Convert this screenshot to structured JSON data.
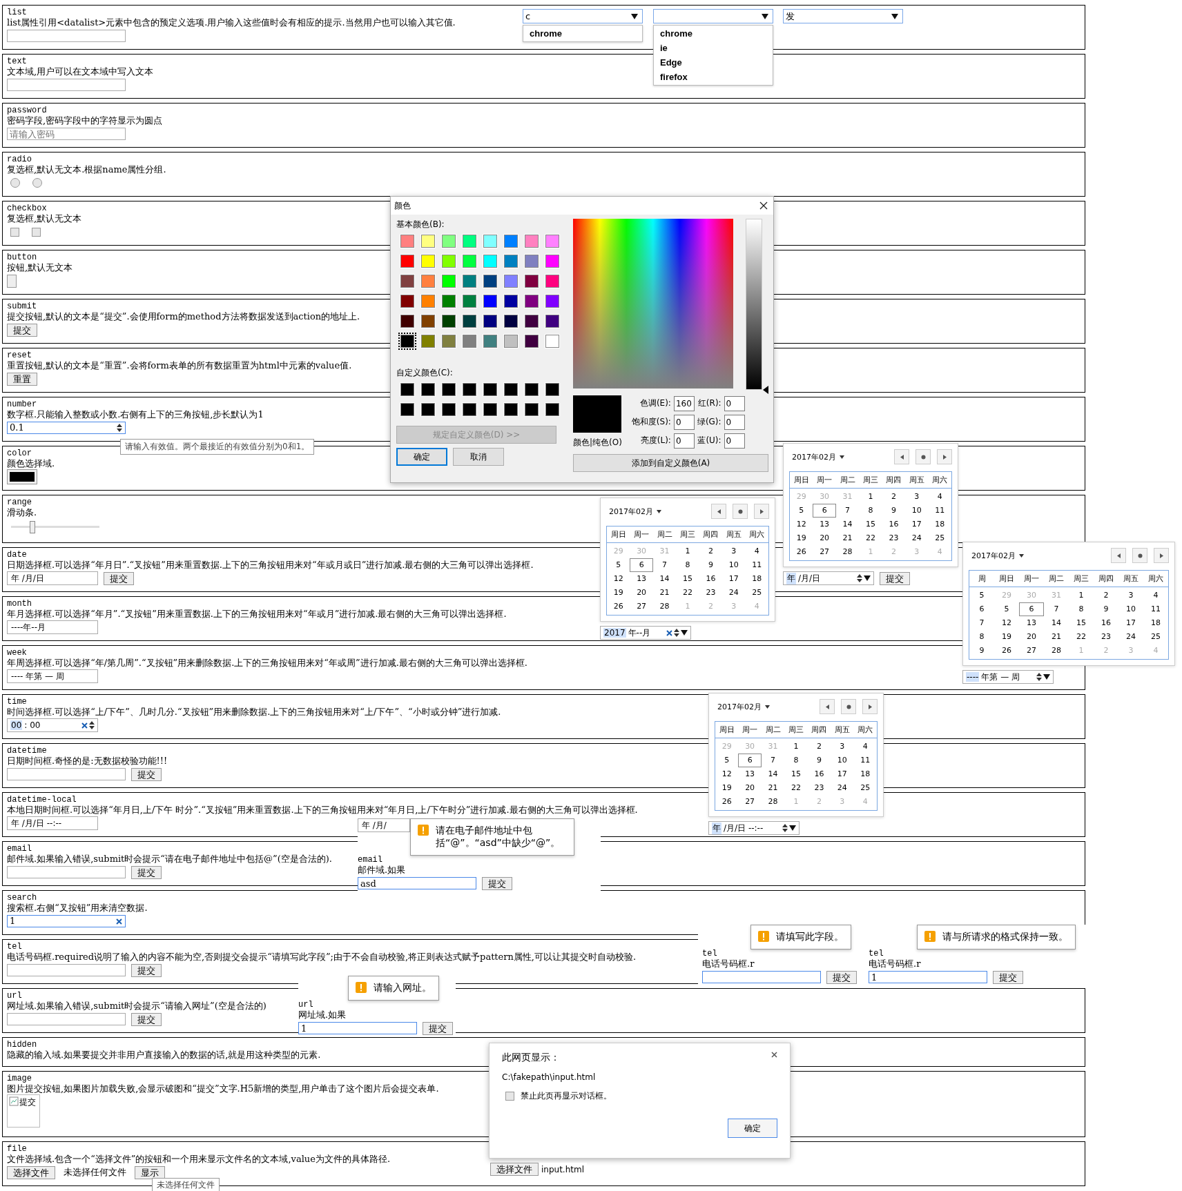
{
  "sections": [
    {
      "type": "list",
      "description": "list属性引用<datalist>元素中包含的预定义选项.用户输入这些值时会有相应的提示.当然用户也可以输入其它值.",
      "controls": [
        {
          "kind": "input"
        }
      ]
    },
    {
      "type": "text",
      "description": "文本域,用户可以在文本域中写入文本",
      "controls": [
        {
          "kind": "input"
        }
      ]
    },
    {
      "type": "password",
      "description": "密码字段,密码字段中的字符显示为圆点",
      "controls": [
        {
          "kind": "input",
          "placeholder": "请输入密码"
        }
      ]
    },
    {
      "type": "radio",
      "description": "复选框,默认无文本.根据name属性分组.",
      "controls": [
        {
          "kind": "radio",
          "checked": false
        },
        {
          "kind": "radio",
          "checked": false
        }
      ]
    },
    {
      "type": "checkbox",
      "description": "复选框,默认无文本",
      "controls": [
        {
          "kind": "checkbox",
          "checked": false
        },
        {
          "kind": "checkbox",
          "checked": false
        }
      ]
    },
    {
      "type": "button",
      "description": "按钮,默认无文本",
      "controls": [
        {
          "kind": "button"
        }
      ]
    },
    {
      "type": "submit",
      "description": "提交按钮,默认的文本是“提交”.会使用form的method方法将数据发送到action的地址上.",
      "controls": [
        {
          "kind": "button",
          "label": "提交"
        }
      ]
    },
    {
      "type": "reset",
      "description": "重置按钮,默认的文本是“重置”.会将form表单的所有数据重置为html中元素的value值.",
      "controls": [
        {
          "kind": "button",
          "label": "重置"
        }
      ]
    },
    {
      "type": "number",
      "description": "数字框.只能输入整数或小数.右侧有上下的三角按钮,步长默认为1",
      "controls": [
        {
          "kind": "input",
          "value": "0.1",
          "focused": true,
          "spinner": true
        }
      ]
    },
    {
      "type": "color",
      "description": "颜色选择域.",
      "controls": [
        {
          "kind": "color"
        }
      ]
    },
    {
      "type": "range",
      "description": "滑动条.",
      "controls": [
        {
          "kind": "range",
          "level": 0.24
        }
      ]
    },
    {
      "type": "date",
      "description": "日期选择框.可以选择“年月日”.“叉按钮”用来重置数据.上下的三角按钮用来对“年或月或日”进行加减.最右侧的大三角可以弹出选择框.",
      "controls": [
        {
          "kind": "datefield",
          "segments": [
            {
              "text": "年 /月/日",
              "selected": false
            }
          ]
        },
        {
          "kind": "button",
          "label": "提交"
        }
      ]
    },
    {
      "type": "month",
      "description": "年月选择框.可以选择“年月”.“叉按钮”用来重置数据.上下的三角按钮用来对“年或月”进行加减.最右侧的大三角可以弹出选择框.",
      "controls": [
        {
          "kind": "datefield",
          "segments": [
            {
              "text": "----年--月",
              "selected": false
            }
          ]
        }
      ]
    },
    {
      "type": "week",
      "description": "年周选择框.可以选择“年/第几周”.“叉按钮”用来删除数据.上下的三角按钮用来对“年或周”进行加减.最右侧的大三角可以弹出选择框.",
      "controls": [
        {
          "kind": "datefield",
          "segments": [
            {
              "text": "---- 年第 — 周",
              "selected": false
            }
          ]
        }
      ]
    },
    {
      "type": "time",
      "description": "时间选择框.可以选择“上/下午”、几时几分.“叉按钮”用来删除数据.上下的三角按钮用来对“上/下午”、“小时或分钟”进行加减.",
      "controls": [
        {
          "kind": "datefield",
          "segments": [
            {
              "text": "00",
              "selected": true
            },
            {
              "text": ": 00",
              "selected": false
            }
          ],
          "clear": true,
          "spinner": true
        }
      ]
    },
    {
      "type": "datetime",
      "description": "日期时间框.奇怪的是:无数据校验功能!!!",
      "controls": [
        {
          "kind": "input"
        },
        {
          "kind": "button",
          "label": "提交"
        }
      ]
    },
    {
      "type": "datetime-local",
      "description": "本地日期时间框.可以选择“年月日,上/下午 时分”.“叉按钮”用来重置数据.上下的三角按钮用来对“年月日,上/下午时分”进行加减.最右侧的大三角可以弹出选择框.",
      "controls": [
        {
          "kind": "datefield",
          "segments": [
            {
              "text": "年 /月/日 --:--",
              "selected": false
            }
          ]
        }
      ]
    },
    {
      "type": "email",
      "description": "邮件域.如果输入错误,submit时会提示“请在电子邮件地址中包括@”(空是合法的).",
      "controls": [
        {
          "kind": "input"
        },
        {
          "kind": "button",
          "label": "提交"
        }
      ]
    },
    {
      "type": "search",
      "description": "搜索框.右侧“叉按钮”用来清空数据.",
      "controls": [
        {
          "kind": "input",
          "value": "1",
          "focused": true,
          "clear": true
        }
      ]
    },
    {
      "type": "tel",
      "description": "电话号码框.required说明了输入的内容不能为空,否则提交会提示“请填写此字段”;由于不会自动校验,将正则表达式赋予pattern属性,可以让其提交时自动校验.",
      "controls": [
        {
          "kind": "input"
        },
        {
          "kind": "button",
          "label": "提交"
        }
      ]
    },
    {
      "type": "url",
      "description": "网址域.如果输入错误,submit时会提示“请输入网址”(空是合法的)",
      "controls": [
        {
          "kind": "input"
        },
        {
          "kind": "button",
          "label": "提交"
        }
      ]
    },
    {
      "type": "hidden",
      "description": "隐藏的输入域.如果要提交并非用户直接输入的数据的话,就是用这种类型的元素."
    },
    {
      "type": "image",
      "description": "图片提交按钮,如果图片加载失败,会显示破图和“提交”文字.H5新增的类型,用户单击了这个图片后会提交表单.",
      "controls": [
        {
          "kind": "image",
          "alt": "提交"
        }
      ]
    },
    {
      "type": "file",
      "description": "文件选择域.包含一个“选择文件”的按钮和一个用来显示文件名的文本域,value为文件的具体路径.",
      "controls": [
        {
          "kind": "file",
          "button": "选择文件",
          "filename": "未选择任何文件"
        },
        {
          "kind": "button",
          "label": "显示"
        }
      ]
    }
  ],
  "datalist_combos": [
    {
      "value": "c",
      "options": [
        "chrome"
      ]
    },
    {
      "options": [
        "chrome",
        "ie",
        "Edge",
        "firefox"
      ]
    },
    {
      "value": "发"
    }
  ],
  "number_tooltip": "请输入有效值。两个最接近的有效值分别为0和1。",
  "color_dialog": {
    "title": "颜色",
    "basic_label": "基本颜色(B):",
    "basic_colors": [
      {
        "color": "#ff8080",
        "selected": false
      },
      {
        "color": "#ffff80",
        "selected": false
      },
      {
        "color": "#80ff80",
        "selected": false
      },
      {
        "color": "#00ff80",
        "selected": false
      },
      {
        "color": "#80ffff",
        "selected": false
      },
      {
        "color": "#0080ff",
        "selected": false
      },
      {
        "color": "#ff80c0",
        "selected": false
      },
      {
        "color": "#ff80ff",
        "selected": false
      },
      {
        "color": "#ff0000",
        "selected": false
      },
      {
        "color": "#ffff00",
        "selected": false
      },
      {
        "color": "#80ff00",
        "selected": false
      },
      {
        "color": "#00ff40",
        "selected": false
      },
      {
        "color": "#00ffff",
        "selected": false
      },
      {
        "color": "#0080c0",
        "selected": false
      },
      {
        "color": "#8080c0",
        "selected": false
      },
      {
        "color": "#ff00ff",
        "selected": false
      },
      {
        "color": "#804040",
        "selected": false
      },
      {
        "color": "#ff8040",
        "selected": false
      },
      {
        "color": "#00ff00",
        "selected": false
      },
      {
        "color": "#008080",
        "selected": false
      },
      {
        "color": "#004080",
        "selected": false
      },
      {
        "color": "#8080ff",
        "selected": false
      },
      {
        "color": "#800040",
        "selected": false
      },
      {
        "color": "#ff0080",
        "selected": false
      },
      {
        "color": "#800000",
        "selected": false
      },
      {
        "color": "#ff8000",
        "selected": false
      },
      {
        "color": "#008000",
        "selected": false
      },
      {
        "color": "#008040",
        "selected": false
      },
      {
        "color": "#0000ff",
        "selected": false
      },
      {
        "color": "#0000a0",
        "selected": false
      },
      {
        "color": "#800080",
        "selected": false
      },
      {
        "color": "#8000ff",
        "selected": false
      },
      {
        "color": "#400000",
        "selected": false
      },
      {
        "color": "#804000",
        "selected": false
      },
      {
        "color": "#004000",
        "selected": false
      },
      {
        "color": "#004040",
        "selected": false
      },
      {
        "color": "#000080",
        "selected": false
      },
      {
        "color": "#000040",
        "selected": false
      },
      {
        "color": "#400040",
        "selected": false
      },
      {
        "color": "#400080",
        "selected": false
      },
      {
        "color": "#000000",
        "selected": true
      },
      {
        "color": "#808000",
        "selected": false
      },
      {
        "color": "#808040",
        "selected": false
      },
      {
        "color": "#808080",
        "selected": false
      },
      {
        "color": "#408080",
        "selected": false
      },
      {
        "color": "#c0c0c0",
        "selected": false
      },
      {
        "color": "#400040",
        "selected": false
      },
      {
        "color": "#ffffff",
        "selected": false
      }
    ],
    "luminance_slider": {
      "level": 0
    },
    "custom_label": "自定义颜色(C):",
    "custom_colors": [
      {
        "color": "#000000"
      },
      {
        "color": "#000000"
      },
      {
        "color": "#000000"
      },
      {
        "color": "#000000"
      },
      {
        "color": "#000000"
      },
      {
        "color": "#000000"
      },
      {
        "color": "#000000"
      },
      {
        "color": "#000000"
      },
      {
        "color": "#000000"
      },
      {
        "color": "#000000"
      },
      {
        "color": "#000000"
      },
      {
        "color": "#000000"
      },
      {
        "color": "#000000"
      },
      {
        "color": "#000000"
      },
      {
        "color": "#000000"
      },
      {
        "color": "#000000"
      }
    ],
    "define_button": {
      "label": "规定自定义颜色(D) >>",
      "disabled": true
    },
    "ok_button": "确定",
    "cancel_button": "取消",
    "preview_label": "颜色|纯色(O)",
    "fields": [
      {
        "label": "色调(E):",
        "value": "160"
      },
      {
        "label": "红(R):",
        "value": "0"
      },
      {
        "label": "饱和度(S):",
        "value": "0"
      },
      {
        "label": "绿(G):",
        "value": "0"
      },
      {
        "label": "亮度(L):",
        "value": "0"
      },
      {
        "label": "蓝(U):",
        "value": "0"
      }
    ],
    "add_button": "添加到自定义颜色(A)"
  },
  "calendars": [
    {
      "month": "2017年02月",
      "weekdays": [
        "周日",
        "周一",
        "周二",
        "周三",
        "周四",
        "周五",
        "周六"
      ],
      "weeks": [
        {
          "days": [
            {
              "day": "29",
              "outside": true,
              "selected": false
            },
            {
              "day": "30",
              "outside": true,
              "selected": false
            },
            {
              "day": "31",
              "outside": true,
              "selected": false
            },
            {
              "day": "1",
              "outside": false,
              "selected": false
            },
            {
              "day": "2",
              "outside": false,
              "selected": false
            },
            {
              "day": "3",
              "outside": false,
              "selected": false
            },
            {
              "day": "4",
              "outside": false,
              "selected": false
            }
          ]
        },
        {
          "days": [
            {
              "day": "5",
              "outside": false,
              "selected": false
            },
            {
              "day": "6",
              "outside": false,
              "selected": true
            },
            {
              "day": "7",
              "outside": false,
              "selected": false
            },
            {
              "day": "8",
              "outside": false,
              "selected": false
            },
            {
              "day": "9",
              "outside": false,
              "selected": false
            },
            {
              "day": "10",
              "outside": false,
              "selected": false
            },
            {
              "day": "11",
              "outside": false,
              "selected": false
            }
          ]
        },
        {
          "days": [
            {
              "day": "12",
              "outside": false,
              "selected": false
            },
            {
              "day": "13",
              "outside": false,
              "selected": false
            },
            {
              "day": "14",
              "outside": false,
              "selected": false
            },
            {
              "day": "15",
              "outside": false,
              "selected": false
            },
            {
              "day": "16",
              "outside": false,
              "selected": false
            },
            {
              "day": "17",
              "outside": false,
              "selected": false
            },
            {
              "day": "18",
              "outside": false,
              "selected": false
            }
          ]
        },
        {
          "days": [
            {
              "day": "19",
              "outside": false,
              "selected": false
            },
            {
              "day": "20",
              "outside": false,
              "selected": false
            },
            {
              "day": "21",
              "outside": false,
              "selected": false
            },
            {
              "day": "22",
              "outside": false,
              "selected": false
            },
            {
              "day": "23",
              "outside": false,
              "selected": false
            },
            {
              "day": "24",
              "outside": false,
              "selected": false
            },
            {
              "day": "25",
              "outside": false,
              "selected": false
            }
          ]
        },
        {
          "days": [
            {
              "day": "26",
              "outside": false,
              "selected": false
            },
            {
              "day": "27",
              "outside": false,
              "selected": false
            },
            {
              "day": "28",
              "outside": false,
              "selected": false
            },
            {
              "day": "1",
              "outside": true,
              "selected": false
            },
            {
              "day": "2",
              "outside": true,
              "selected": false
            },
            {
              "day": "3",
              "outside": true,
              "selected": false
            },
            {
              "day": "4",
              "outside": true,
              "selected": false
            }
          ]
        }
      ],
      "field": {
        "segments": [
          {
            "text": "2017",
            "selected": true
          },
          {
            "text": "年--月",
            "selected": false
          }
        ],
        "clear": true,
        "spinner": true,
        "dropdown": true
      }
    },
    {
      "month": "2017年02月",
      "weekdays": [
        "周日",
        "周一",
        "周二",
        "周三",
        "周四",
        "周五",
        "周六"
      ],
      "weeks": [
        {
          "days": [
            {
              "day": "29",
              "outside": true,
              "selected": false
            },
            {
              "day": "30",
              "outside": true,
              "selected": false
            },
            {
              "day": "31",
              "outside": true,
              "selected": false
            },
            {
              "day": "1",
              "outside": false,
              "selected": false
            },
            {
              "day": "2",
              "outside": false,
              "selected": false
            },
            {
              "day": "3",
              "outside": false,
              "selected": false
            },
            {
              "day": "4",
              "outside": false,
              "selected": false
            }
          ]
        },
        {
          "days": [
            {
              "day": "5",
              "outside": false,
              "selected": false
            },
            {
              "day": "6",
              "outside": false,
              "selected": true
            },
            {
              "day": "7",
              "outside": false,
              "selected": false
            },
            {
              "day": "8",
              "outside": false,
              "selected": false
            },
            {
              "day": "9",
              "outside": false,
              "selected": false
            },
            {
              "day": "10",
              "outside": false,
              "selected": false
            },
            {
              "day": "11",
              "outside": false,
              "selected": false
            }
          ]
        },
        {
          "days": [
            {
              "day": "12",
              "outside": false,
              "selected": false
            },
            {
              "day": "13",
              "outside": false,
              "selected": false
            },
            {
              "day": "14",
              "outside": false,
              "selected": false
            },
            {
              "day": "15",
              "outside": false,
              "selected": false
            },
            {
              "day": "16",
              "outside": false,
              "selected": false
            },
            {
              "day": "17",
              "outside": false,
              "selected": false
            },
            {
              "day": "18",
              "outside": false,
              "selected": false
            }
          ]
        },
        {
          "days": [
            {
              "day": "19",
              "outside": false,
              "selected": false
            },
            {
              "day": "20",
              "outside": false,
              "selected": false
            },
            {
              "day": "21",
              "outside": false,
              "selected": false
            },
            {
              "day": "22",
              "outside": false,
              "selected": false
            },
            {
              "day": "23",
              "outside": false,
              "selected": false
            },
            {
              "day": "24",
              "outside": false,
              "selected": false
            },
            {
              "day": "25",
              "outside": false,
              "selected": false
            }
          ]
        },
        {
          "days": [
            {
              "day": "26",
              "outside": false,
              "selected": false
            },
            {
              "day": "27",
              "outside": false,
              "selected": false
            },
            {
              "day": "28",
              "outside": false,
              "selected": false
            },
            {
              "day": "1",
              "outside": true,
              "selected": false
            },
            {
              "day": "2",
              "outside": true,
              "selected": false
            },
            {
              "day": "3",
              "outside": true,
              "selected": false
            },
            {
              "day": "4",
              "outside": true,
              "selected": false
            }
          ]
        }
      ],
      "field": {
        "segments": [
          {
            "text": "年",
            "selected": true
          },
          {
            "text": "/月/日",
            "selected": false
          }
        ],
        "spinner": true,
        "dropdown": true
      },
      "button": "提交"
    },
    {
      "month": "2017年02月",
      "week_header": "周",
      "weekdays": [
        "周日",
        "周一",
        "周二",
        "周三",
        "周四",
        "周五",
        "周六"
      ],
      "weeks": [
        {
          "number": "5",
          "days": [
            {
              "day": "29",
              "outside": true,
              "selected": false
            },
            {
              "day": "30",
              "outside": true,
              "selected": false
            },
            {
              "day": "31",
              "outside": true,
              "selected": false
            },
            {
              "day": "1",
              "outside": false,
              "selected": false
            },
            {
              "day": "2",
              "outside": false,
              "selected": false
            },
            {
              "day": "3",
              "outside": false,
              "selected": false
            },
            {
              "day": "4",
              "outside": false,
              "selected": false
            }
          ]
        },
        {
          "number": "6",
          "days": [
            {
              "day": "5",
              "outside": false,
              "selected": false
            },
            {
              "day": "6",
              "outside": false,
              "selected": true
            },
            {
              "day": "7",
              "outside": false,
              "selected": false
            },
            {
              "day": "8",
              "outside": false,
              "selected": false
            },
            {
              "day": "9",
              "outside": false,
              "selected": false
            },
            {
              "day": "10",
              "outside": false,
              "selected": false
            },
            {
              "day": "11",
              "outside": false,
              "selected": false
            }
          ]
        },
        {
          "number": "7",
          "days": [
            {
              "day": "12",
              "outside": false,
              "selected": false
            },
            {
              "day": "13",
              "outside": false,
              "selected": false
            },
            {
              "day": "14",
              "outside": false,
              "selected": false
            },
            {
              "day": "15",
              "outside": false,
              "selected": false
            },
            {
              "day": "16",
              "outside": false,
              "selected": false
            },
            {
              "day": "17",
              "outside": false,
              "selected": false
            },
            {
              "day": "18",
              "outside": false,
              "selected": false
            }
          ]
        },
        {
          "number": "8",
          "days": [
            {
              "day": "19",
              "outside": false,
              "selected": false
            },
            {
              "day": "20",
              "outside": false,
              "selected": false
            },
            {
              "day": "21",
              "outside": false,
              "selected": false
            },
            {
              "day": "22",
              "outside": false,
              "selected": false
            },
            {
              "day": "23",
              "outside": false,
              "selected": false
            },
            {
              "day": "24",
              "outside": false,
              "selected": false
            },
            {
              "day": "25",
              "outside": false,
              "selected": false
            }
          ]
        },
        {
          "number": "9",
          "days": [
            {
              "day": "26",
              "outside": false,
              "selected": false
            },
            {
              "day": "27",
              "outside": false,
              "selected": false
            },
            {
              "day": "28",
              "outside": false,
              "selected": false
            },
            {
              "day": "1",
              "outside": true,
              "selected": false
            },
            {
              "day": "2",
              "outside": true,
              "selected": false
            },
            {
              "day": "3",
              "outside": true,
              "selected": false
            },
            {
              "day": "4",
              "outside": true,
              "selected": false
            }
          ]
        }
      ],
      "field": {
        "segments": [
          {
            "text": "----",
            "selected": true
          },
          {
            "text": "年第 — 周",
            "selected": false
          }
        ],
        "spinner": true,
        "dropdown": true
      }
    },
    {
      "month": "2017年02月",
      "weekdays": [
        "周日",
        "周一",
        "周二",
        "周三",
        "周四",
        "周五",
        "周六"
      ],
      "weeks": [
        {
          "days": [
            {
              "day": "29",
              "outside": true,
              "selected": false
            },
            {
              "day": "30",
              "outside": true,
              "selected": false
            },
            {
              "day": "31",
              "outside": true,
              "selected": false
            },
            {
              "day": "1",
              "outside": false,
              "selected": false
            },
            {
              "day": "2",
              "outside": false,
              "selected": false
            },
            {
              "day": "3",
              "outside": false,
              "selected": false
            },
            {
              "day": "4",
              "outside": false,
              "selected": false
            }
          ]
        },
        {
          "days": [
            {
              "day": "5",
              "outside": false,
              "selected": false
            },
            {
              "day": "6",
              "outside": false,
              "selected": true
            },
            {
              "day": "7",
              "outside": false,
              "selected": false
            },
            {
              "day": "8",
              "outside": false,
              "selected": false
            },
            {
              "day": "9",
              "outside": false,
              "selected": false
            },
            {
              "day": "10",
              "outside": false,
              "selected": false
            },
            {
              "day": "11",
              "outside": false,
              "selected": false
            }
          ]
        },
        {
          "days": [
            {
              "day": "12",
              "outside": false,
              "selected": false
            },
            {
              "day": "13",
              "outside": false,
              "selected": false
            },
            {
              "day": "14",
              "outside": false,
              "selected": false
            },
            {
              "day": "15",
              "outside": false,
              "selected": false
            },
            {
              "day": "16",
              "outside": false,
              "selected": false
            },
            {
              "day": "17",
              "outside": false,
              "selected": false
            },
            {
              "day": "18",
              "outside": false,
              "selected": false
            }
          ]
        },
        {
          "days": [
            {
              "day": "19",
              "outside": false,
              "selected": false
            },
            {
              "day": "20",
              "outside": false,
              "selected": false
            },
            {
              "day": "21",
              "outside": false,
              "selected": false
            },
            {
              "day": "22",
              "outside": false,
              "selected": false
            },
            {
              "day": "23",
              "outside": false,
              "selected": false
            },
            {
              "day": "24",
              "outside": false,
              "selected": false
            },
            {
              "day": "25",
              "outside": false,
              "selected": false
            }
          ]
        },
        {
          "days": [
            {
              "day": "26",
              "outside": false,
              "selected": false
            },
            {
              "day": "27",
              "outside": false,
              "selected": false
            },
            {
              "day": "28",
              "outside": false,
              "selected": false
            },
            {
              "day": "1",
              "outside": true,
              "selected": false
            },
            {
              "day": "2",
              "outside": true,
              "selected": false
            },
            {
              "day": "3",
              "outside": true,
              "selected": false
            },
            {
              "day": "4",
              "outside": true,
              "selected": false
            }
          ]
        }
      ],
      "field": {
        "segments": [
          {
            "text": "年",
            "selected": true
          },
          {
            "text": "/月/日 --:--",
            "selected": false
          }
        ],
        "spinner": true,
        "dropdown": true
      }
    }
  ],
  "email_overlay": {
    "datefield": {
      "segments": [
        {
          "text": "年 /月/",
          "selected": false
        }
      ]
    },
    "tooltip": "请在电子邮件地址中包括“@”。“asd”中缺少“@”。",
    "type": "email",
    "description": "邮件域.如果",
    "value": "asd",
    "button": "提交"
  },
  "tel_overlays": [
    {
      "tooltip": "请填写此字段。",
      "type": "tel",
      "description": "电话号码框.r",
      "button": "提交"
    },
    {
      "tooltip": "请与所请求的格式保持一致。",
      "type": "tel",
      "description": "电话号码框.r",
      "value": "1",
      "button": "提交"
    }
  ],
  "url_overlay": {
    "tooltip": "请输入网址。",
    "type": "url",
    "description": "网址域.如果",
    "value": "1",
    "button": "提交"
  },
  "alert": {
    "title": "此网页显示：",
    "message": "C:\\fakepath\\input.html",
    "checkbox": {
      "label": "禁止此页再显示对话框。",
      "checked": false
    },
    "ok_button": "确定"
  },
  "file_overlay": {
    "button": "选择文件",
    "filename": "input.html"
  },
  "file_tooltip": "未选择任何文件"
}
